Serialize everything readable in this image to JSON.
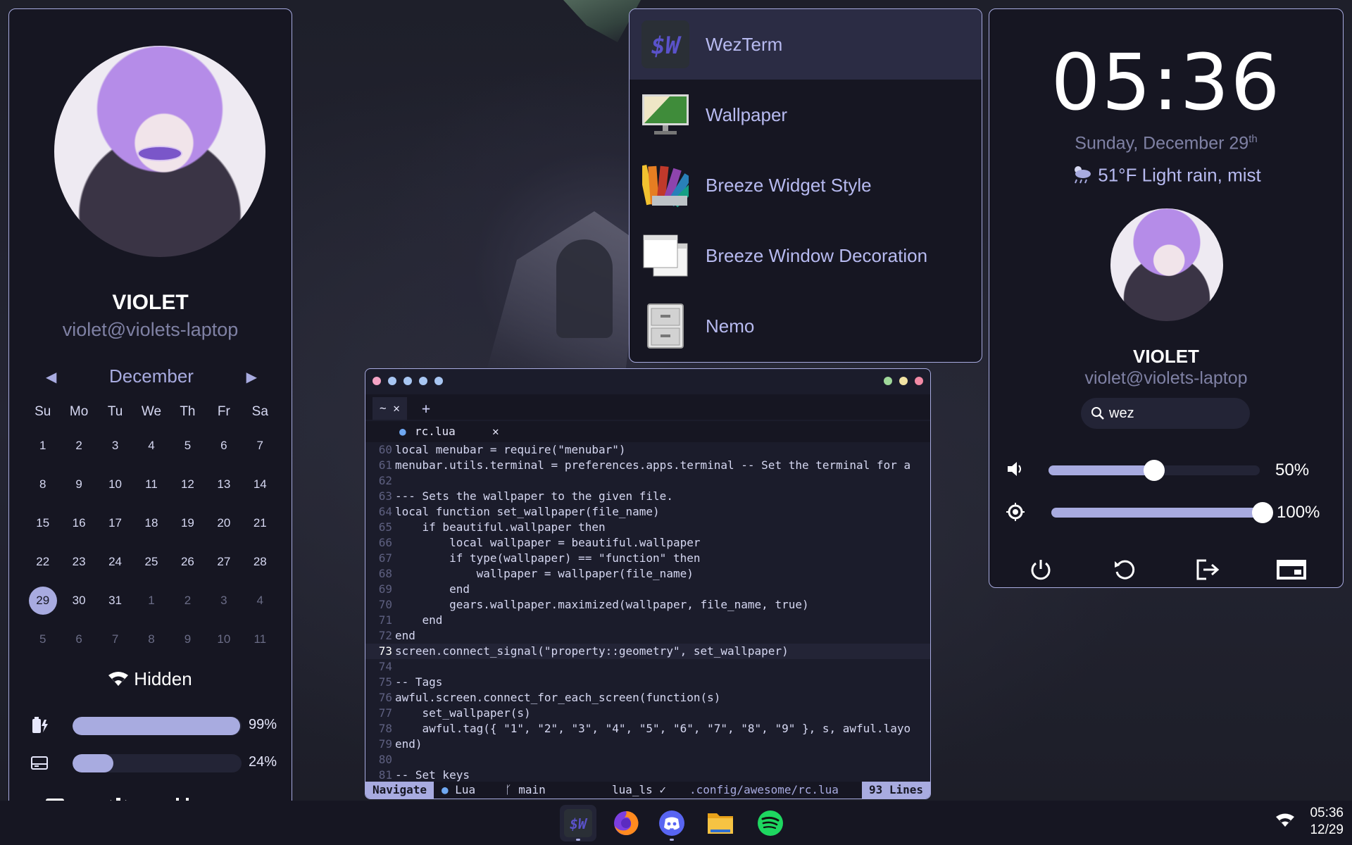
{
  "left_panel": {
    "user_name": "VIOLET",
    "user_host": "violet@violets-laptop",
    "calendar": {
      "month": "December",
      "weekdays": [
        "Su",
        "Mo",
        "Tu",
        "We",
        "Th",
        "Fr",
        "Sa"
      ],
      "days": [
        "1",
        "2",
        "3",
        "4",
        "5",
        "6",
        "7",
        "8",
        "9",
        "10",
        "11",
        "12",
        "13",
        "14",
        "15",
        "16",
        "17",
        "18",
        "19",
        "20",
        "21",
        "22",
        "23",
        "24",
        "25",
        "26",
        "27",
        "28",
        "29",
        "30",
        "31",
        "1",
        "2",
        "3",
        "4",
        "5",
        "6",
        "7",
        "8",
        "9",
        "10",
        "11"
      ],
      "today": "29"
    },
    "wifi_label": "Hidden",
    "battery_percent": 99,
    "battery_label": "99%",
    "disk_percent": 24,
    "disk_label": "24%",
    "bottom_icons": [
      "calculator-icon",
      "settings-icon",
      "calendar-icon",
      "mail-icon"
    ]
  },
  "launcher": {
    "items": [
      {
        "label": "WezTerm",
        "icon": "wezterm-icon",
        "selected": true
      },
      {
        "label": "Wallpaper",
        "icon": "wallpaper-icon",
        "selected": false
      },
      {
        "label": "Breeze Widget Style",
        "icon": "color-palette-icon",
        "selected": false
      },
      {
        "label": "Breeze Window Decoration",
        "icon": "window-decoration-icon",
        "selected": false
      },
      {
        "label": "Nemo",
        "icon": "file-cabinet-icon",
        "selected": false
      }
    ]
  },
  "terminal": {
    "tab_label": "~",
    "buffer_name": "rc.lua",
    "lines": [
      {
        "n": "60",
        "t": "local menubar = require(\"menubar\")"
      },
      {
        "n": "61",
        "t": "menubar.utils.terminal = preferences.apps.terminal -- Set the terminal for a"
      },
      {
        "n": "62",
        "t": ""
      },
      {
        "n": "63",
        "t": "--- Sets the wallpaper to the given file."
      },
      {
        "n": "64",
        "t": "local function set_wallpaper(file_name)"
      },
      {
        "n": "65",
        "t": "    if beautiful.wallpaper then"
      },
      {
        "n": "66",
        "t": "        local wallpaper = beautiful.wallpaper"
      },
      {
        "n": "67",
        "t": "        if type(wallpaper) == \"function\" then"
      },
      {
        "n": "68",
        "t": "            wallpaper = wallpaper(file_name)"
      },
      {
        "n": "69",
        "t": "        end"
      },
      {
        "n": "70",
        "t": "        gears.wallpaper.maximized(wallpaper, file_name, true)"
      },
      {
        "n": "71",
        "t": "    end"
      },
      {
        "n": "72",
        "t": "end"
      },
      {
        "n": "73",
        "t": "screen.connect_signal(\"property::geometry\", set_wallpaper)"
      },
      {
        "n": "74",
        "t": ""
      },
      {
        "n": "75",
        "t": "-- Tags"
      },
      {
        "n": "76",
        "t": "awful.screen.connect_for_each_screen(function(s)"
      },
      {
        "n": "77",
        "t": "    set_wallpaper(s)"
      },
      {
        "n": "78",
        "t": "    awful.tag({ \"1\", \"2\", \"3\", \"4\", \"5\", \"6\", \"7\", \"8\", \"9\" }, s, awful.layo"
      },
      {
        "n": "79",
        "t": "end)"
      },
      {
        "n": "80",
        "t": ""
      },
      {
        "n": "81",
        "t": "-- Set keys"
      }
    ],
    "current_line": "73",
    "status": {
      "mode": "Navigate",
      "filetype": "Lua",
      "branch": "main",
      "lsp": "lua_ls ✓",
      "path": ".config/awesome/rc.lua",
      "lines": "93 Lines"
    }
  },
  "right_panel": {
    "clock": "05:36",
    "date": "Sunday, December 29",
    "date_suffix": "th",
    "weather": "51°F Light rain, mist",
    "user_name": "VIOLET",
    "user_host": "violet@violets-laptop",
    "search_value": "wez",
    "volume_percent": 50,
    "volume_label": "50%",
    "brightness_percent": 100,
    "brightness_label": "100%",
    "power_buttons": [
      "power-icon",
      "reboot-icon",
      "logout-icon",
      "lock-icon"
    ]
  },
  "taskbar": {
    "apps": [
      "wezterm-icon",
      "firefox-icon",
      "discord-icon",
      "files-icon",
      "spotify-icon"
    ],
    "time": "05:36",
    "date": "12/29"
  },
  "colors": {
    "accent": "#a8abe0",
    "panel_bg": "#161622",
    "text": "#ffffff"
  }
}
